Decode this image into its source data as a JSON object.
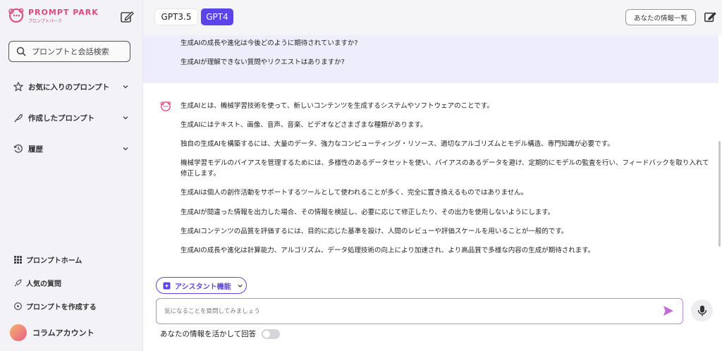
{
  "sidebar": {
    "logo": {
      "name": "PROMPT PARK",
      "sub": "プロンプトパーク"
    },
    "search_placeholder": "プロンプトと会話検索",
    "menu": [
      {
        "label": "お気に入りのプロンプト",
        "icon": "star-icon"
      },
      {
        "label": "作成したプロンプト",
        "icon": "feather-icon"
      },
      {
        "label": "履歴",
        "icon": "history-icon"
      }
    ],
    "bottom": [
      {
        "label": "プロンプトホーム",
        "icon": "grid-icon"
      },
      {
        "label": "人気の質問",
        "icon": "rocket-icon"
      },
      {
        "label": "プロンプトを作成する",
        "icon": "plus-circle-icon"
      }
    ],
    "account": "コラムアカウント"
  },
  "header": {
    "models": [
      "GPT3.5",
      "GPT4"
    ],
    "selected_model": "GPT4",
    "info_button": "あなたの情報一覧"
  },
  "chat": {
    "user_lines": [
      "生成AIの成長や進化は今後どのように期待されていますか?",
      "生成AIが理解できない質問やリクエストはありますか?"
    ],
    "ai_lines": [
      "生成AIとは、機械学習技術を使って、新しいコンテンツを生成するシステムやソフトウェアのことです。",
      "生成AIにはテキスト、画像、音声、音楽、ビデオなどさまざまな種類があります。",
      "独自の生成AIを構築するには、大量のデータ、強力なコンピューティング・リソース、適切なアルゴリズムとモデル構造、専門知識が必要です。",
      "機械学習モデルのバイアスを管理するためには、多様性のあるデータセットを使い、バイアスのあるデータを避け、定期的にモデルの監査を行い、フィードバックを取り入れて修正します。",
      "生成AIは個人の創作活動をサポートするツールとして使われることが多く、完全に置き換えるものではありません。",
      "生成AIが間違った情報を出力した場合、その情報を検証し、必要に応じて修正したり、その出力を使用しないようにします。",
      "生成AIコンテンツの品質を評価するには、目的に応じた基準を設け、人間のレビューや評価スケールを用いることが一般的です。",
      "生成AIの成長や進化は計算能力、アルゴリズム、データ処理技術の向上により加速され、より高品質で多様な内容の生成が期待されます。"
    ]
  },
  "composer": {
    "assistant_button": "アシスタント機能",
    "input_placeholder": "気になることを質問してみましょう",
    "toggle_label": "あなたの情報を活かして回答",
    "toggle_on": false
  },
  "colors": {
    "accent": "#5b45e8",
    "brand": "#e0497a",
    "input_border": "#b88ad8"
  }
}
